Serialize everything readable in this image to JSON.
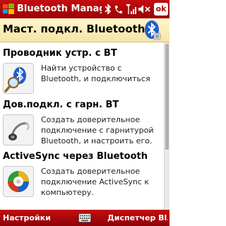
{
  "titlebar": {
    "app_title": "Bluetooth Manager",
    "ok_label": "ok",
    "icons": [
      "windows-logo-icon",
      "bluetooth-status-icon",
      "phone-icon",
      "signal-icon",
      "volume-mute-icon"
    ]
  },
  "header": {
    "title": "Маст. подкл. Bluetooth"
  },
  "sections": [
    {
      "title": "Проводник устр. с BT",
      "description": "Найти устройство с Bluetooth, и подключиться",
      "icon": "bluetooth-search-icon"
    },
    {
      "title": "Дов.подкл. с гарн. BT",
      "description": "Создать доверительное подключение с гарнитурой Bluetooth, и настроить его.",
      "icon": "headset-icon"
    },
    {
      "title": "ActiveSync через Bluetooth",
      "description": "Создать доверительное подключение ActiveSync к компьютеру.",
      "icon": "activesync-icon"
    }
  ],
  "bottombar": {
    "left_label": "Настройки",
    "right_label": "Диспетчер Bl..."
  },
  "colors": {
    "bar_red": "#b3090c",
    "header_cream": "#fbefc0",
    "bluetooth_blue": "#1f5fc9"
  }
}
